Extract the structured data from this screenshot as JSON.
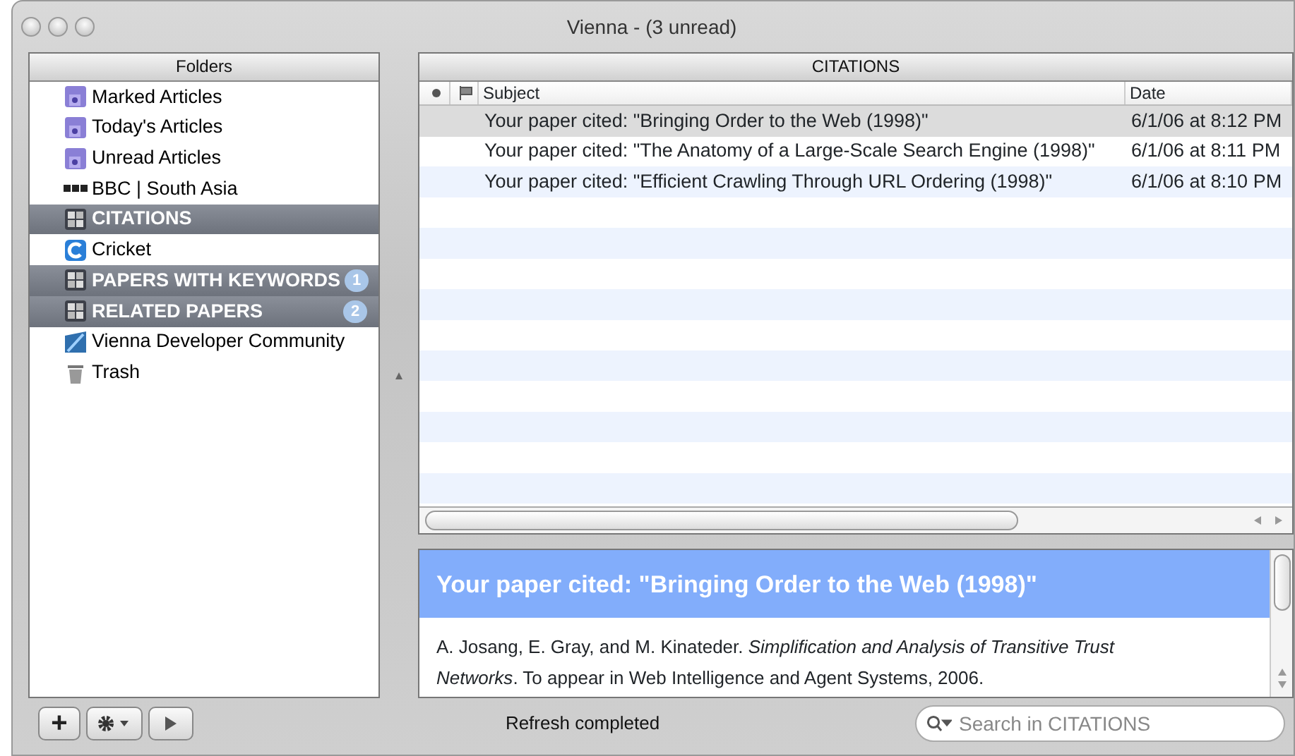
{
  "window": {
    "title": "Vienna - (3 unread)"
  },
  "folders": {
    "header": "Folders",
    "items": [
      {
        "kind": "smart",
        "label": "Marked Articles",
        "selected": false
      },
      {
        "kind": "smart",
        "label": "Today's Articles",
        "selected": false
      },
      {
        "kind": "smart",
        "label": "Unread Articles",
        "selected": false
      },
      {
        "kind": "bbc",
        "label": "BBC | South Asia",
        "selected": false
      },
      {
        "kind": "group",
        "label": "CITATIONS",
        "selected": true
      },
      {
        "kind": "cfeed",
        "label": "Cricket",
        "selected": false
      },
      {
        "kind": "group",
        "label": "PAPERS WITH KEYWORDS",
        "selected": true,
        "unread": "1"
      },
      {
        "kind": "group",
        "label": "RELATED PAPERS",
        "selected": true,
        "unread": "2"
      },
      {
        "kind": "imgfeed",
        "label": "Vienna Developer Community",
        "selected": false
      },
      {
        "kind": "trash",
        "label": "Trash",
        "selected": false
      }
    ]
  },
  "articles": {
    "header": "CITATIONS",
    "columns": [
      "Subject",
      "Date"
    ],
    "rows": [
      {
        "subject": "Your paper cited: \"Bringing Order to the Web (1998)\"",
        "date": "6/1/06 at 8:12 PM",
        "selected": true
      },
      {
        "subject": "Your paper cited: \"The Anatomy of a Large-Scale Search Engine (1998)\"",
        "date": "6/1/06 at 8:11 PM",
        "selected": false
      },
      {
        "subject": "Your paper cited: \"Efficient Crawling Through URL Ordering (1998)\"",
        "date": "6/1/06 at 8:10 PM",
        "selected": false
      }
    ]
  },
  "preview": {
    "title": "Your paper cited: \"Bringing Order to the Web (1998)\"",
    "body": "A. Josang, E. Gray, and M. Kinateder. *Simplification and Analysis of Transitive Trust Networks*. To appear in Web Intelligence and Agent Systems, 2006."
  },
  "toolbar": {
    "buttons": [
      {
        "kind": "add",
        "label": "+"
      },
      {
        "kind": "gear"
      },
      {
        "kind": "play"
      }
    ]
  },
  "status_bar": "Refresh completed",
  "search": {
    "placeholder": "Search in CITATIONS"
  }
}
